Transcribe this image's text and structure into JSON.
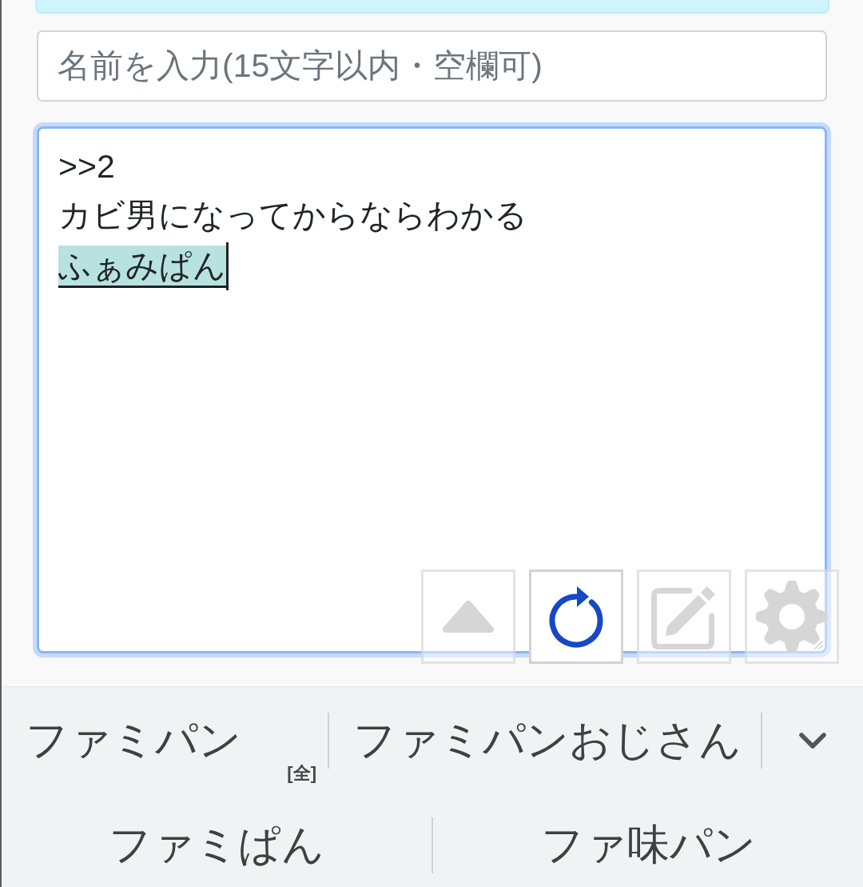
{
  "name_field": {
    "placeholder": "名前を入力(15文字以内・空欄可)"
  },
  "message_field": {
    "lines": [
      ">>2",
      "カビ男になってからならわかる"
    ],
    "composing": "ふぁみぱん"
  },
  "action_buttons": [
    {
      "kind": "scroll-up",
      "disabled": true
    },
    {
      "kind": "reload",
      "disabled": false
    },
    {
      "kind": "edit",
      "disabled": true
    },
    {
      "kind": "settings",
      "disabled": true
    }
  ],
  "candidate_rows": [
    {
      "expandable": true,
      "candidates": [
        {
          "text": "ファミパン",
          "tag": "[全]"
        },
        {
          "text": "ファミパンおじさん"
        }
      ]
    },
    {
      "expandable": false,
      "candidates": [
        {
          "text": "ファミぱん"
        },
        {
          "text": "ファ味パン"
        }
      ]
    }
  ]
}
